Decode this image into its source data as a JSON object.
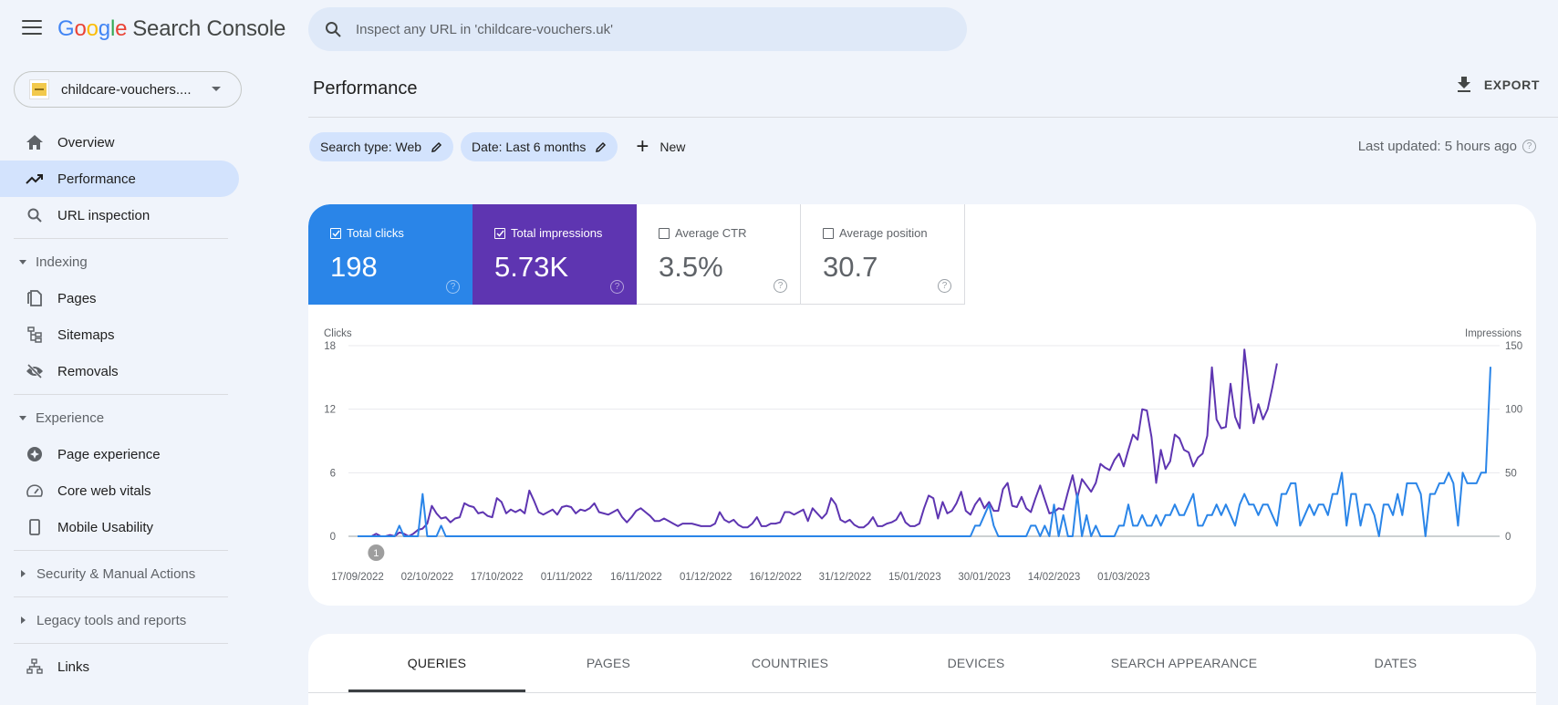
{
  "app": {
    "logo_letters": [
      "G",
      "o",
      "o",
      "g",
      "l",
      "e"
    ],
    "product": "Search Console"
  },
  "property": {
    "label": "childcare-vouchers...."
  },
  "search": {
    "placeholder": "Inspect any URL in 'childcare-vouchers.uk'"
  },
  "sidebar": {
    "items_top": [
      {
        "label": "Overview",
        "icon": "home-icon"
      },
      {
        "label": "Performance",
        "icon": "trending-up-icon",
        "active": true
      },
      {
        "label": "URL inspection",
        "icon": "search-icon"
      }
    ],
    "indexing": {
      "label": "Indexing",
      "items": [
        {
          "label": "Pages",
          "icon": "pages-icon"
        },
        {
          "label": "Sitemaps",
          "icon": "sitemap-icon"
        },
        {
          "label": "Removals",
          "icon": "visibility-off-icon"
        }
      ]
    },
    "experience": {
      "label": "Experience",
      "items": [
        {
          "label": "Page experience",
          "icon": "page-experience-icon"
        },
        {
          "label": "Core web vitals",
          "icon": "speed-gauge-icon"
        },
        {
          "label": "Mobile Usability",
          "icon": "smartphone-icon"
        }
      ]
    },
    "security": {
      "label": "Security & Manual Actions"
    },
    "legacy": {
      "label": "Legacy tools and reports"
    },
    "links": {
      "label": "Links",
      "icon": "links-icon"
    }
  },
  "header": {
    "title": "Performance",
    "export_label": "EXPORT",
    "last_updated": "Last updated: 5 hours ago"
  },
  "filters": [
    {
      "label": "Search type: Web"
    },
    {
      "label": "Date: Last 6 months"
    }
  ],
  "new_label": "New",
  "metrics": [
    {
      "label": "Total clicks",
      "value": "198",
      "checked": true,
      "color": "#2a85e8"
    },
    {
      "label": "Total impressions",
      "value": "5.73K",
      "checked": true,
      "color": "#5e35b1"
    },
    {
      "label": "Average CTR",
      "value": "3.5%",
      "checked": false
    },
    {
      "label": "Average position",
      "value": "30.7",
      "checked": false
    }
  ],
  "tabs": [
    {
      "label": "QUERIES",
      "active": true
    },
    {
      "label": "PAGES"
    },
    {
      "label": "COUNTRIES"
    },
    {
      "label": "DEVICES"
    },
    {
      "label": "SEARCH APPEARANCE"
    },
    {
      "label": "DATES"
    }
  ],
  "chart_data": {
    "type": "line",
    "title": "",
    "y_left_label": "Clicks",
    "y_right_label": "Impressions",
    "y_left_ticks": [
      0,
      6,
      12,
      18
    ],
    "y_right_ticks": [
      0,
      50,
      100,
      150
    ],
    "y_left_range": [
      0,
      18
    ],
    "y_right_range": [
      0,
      150
    ],
    "x_tick_labels": [
      "17/09/2022",
      "02/10/2022",
      "17/10/2022",
      "01/11/2022",
      "16/11/2022",
      "01/12/2022",
      "16/12/2022",
      "31/12/2022",
      "15/01/2023",
      "30/01/2023",
      "14/02/2023",
      "01/03/2023"
    ],
    "x_tick_day_index": [
      0,
      15,
      30,
      45,
      60,
      75,
      90,
      105,
      120,
      135,
      150,
      165
    ],
    "start_date": "17/09/2022",
    "annotation": {
      "label": "1",
      "day_index": 4
    },
    "grid": true,
    "legend": "none",
    "series": [
      {
        "name": "Clicks",
        "axis": "left",
        "color": "#2a85e8",
        "values": [
          0,
          0,
          0,
          0,
          0,
          0,
          0,
          0,
          0,
          1,
          0,
          0,
          0,
          0,
          4,
          0,
          0,
          0,
          1,
          0,
          0,
          0,
          0,
          0,
          0,
          0,
          0,
          0,
          0,
          0,
          0,
          0,
          0,
          0,
          0,
          0,
          0,
          0,
          0,
          0,
          0,
          0,
          0,
          0,
          0,
          0,
          0,
          0,
          0,
          0,
          0,
          0,
          0,
          0,
          0,
          0,
          0,
          0,
          0,
          0,
          0,
          0,
          0,
          0,
          0,
          0,
          0,
          0,
          0,
          0,
          0,
          0,
          0,
          0,
          0,
          0,
          0,
          0,
          0,
          0,
          0,
          0,
          0,
          0,
          0,
          0,
          0,
          0,
          0,
          0,
          0,
          0,
          0,
          0,
          0,
          0,
          0,
          0,
          0,
          0,
          0,
          0,
          0,
          0,
          0,
          0,
          0,
          0,
          0,
          0,
          0,
          0,
          0,
          0,
          0,
          0,
          0,
          0,
          0,
          0,
          0,
          0,
          0,
          0,
          0,
          0,
          0,
          0,
          0,
          0,
          0,
          0,
          0,
          1,
          1,
          2,
          3,
          1,
          0,
          0,
          0,
          0,
          0,
          0,
          0,
          1,
          1,
          0,
          1,
          0,
          3,
          0,
          2,
          0,
          0,
          4,
          0,
          2,
          0,
          1,
          0,
          0,
          0,
          0,
          1,
          1,
          3,
          1,
          1,
          2,
          1,
          1,
          2,
          1,
          2,
          2,
          3,
          2,
          2,
          3,
          4,
          1,
          1,
          2,
          2,
          3,
          2,
          3,
          2,
          1,
          3,
          4,
          3,
          3,
          2,
          3,
          3,
          2,
          1,
          4,
          4,
          5,
          5,
          1,
          2,
          3,
          2,
          3,
          3,
          2,
          4,
          4,
          6,
          1,
          4,
          4,
          1,
          3,
          3,
          2,
          0,
          3,
          3,
          2,
          4,
          2,
          5,
          5,
          5,
          4,
          0,
          4,
          4,
          5,
          5,
          6,
          5,
          1,
          6,
          5,
          5,
          5,
          6,
          6,
          16
        ]
      },
      {
        "name": "Impressions",
        "axis": "right",
        "color": "#5e35b1",
        "values": [
          0,
          0,
          0,
          0,
          2,
          0,
          0,
          1,
          0,
          3,
          2,
          0,
          2,
          5,
          6,
          10,
          24,
          18,
          14,
          15,
          11,
          14,
          15,
          26,
          24,
          23,
          18,
          19,
          16,
          15,
          30,
          27,
          18,
          21,
          19,
          21,
          18,
          36,
          28,
          19,
          17,
          19,
          21,
          17,
          23,
          24,
          23,
          18,
          21,
          20,
          22,
          26,
          19,
          18,
          17,
          19,
          21,
          15,
          11,
          15,
          20,
          22,
          19,
          16,
          12,
          12,
          14,
          12,
          10,
          8,
          10,
          10,
          10,
          9,
          8,
          8,
          8,
          10,
          19,
          13,
          11,
          13,
          9,
          7,
          7,
          10,
          15,
          8,
          8,
          10,
          10,
          11,
          19,
          19,
          17,
          19,
          21,
          12,
          22,
          18,
          14,
          18,
          30,
          25,
          13,
          11,
          13,
          9,
          7,
          7,
          10,
          15,
          8,
          8,
          10,
          11,
          13,
          19,
          11,
          8,
          8,
          10,
          22,
          32,
          30,
          14,
          27,
          18,
          20,
          26,
          35,
          20,
          17,
          25,
          30,
          22,
          27,
          20,
          20,
          37,
          42,
          24,
          23,
          31,
          22,
          19,
          30,
          40,
          29,
          18,
          19,
          22,
          21,
          35,
          48,
          30,
          45,
          40,
          35,
          42,
          57,
          54,
          52,
          60,
          65,
          55,
          68,
          80,
          76,
          100,
          99,
          78,
          42,
          68,
          53,
          59,
          80,
          77,
          68,
          66,
          55,
          62,
          65,
          79,
          133,
          92,
          85,
          86,
          120,
          94,
          85,
          147,
          115,
          89,
          104,
          92,
          100,
          117,
          136
        ]
      }
    ]
  }
}
